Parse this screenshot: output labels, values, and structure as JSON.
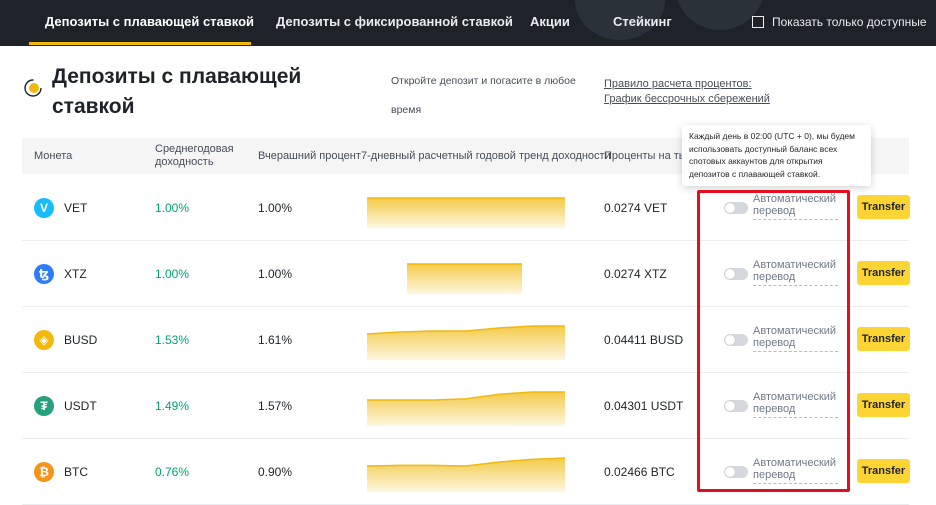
{
  "nav": {
    "tabs": [
      {
        "label": "Депозиты с плавающей ставкой",
        "active": true
      },
      {
        "label": "Депозиты с фиксированной ставкой",
        "active": false
      },
      {
        "label": "Акции",
        "active": false
      },
      {
        "label": "Стейкинг",
        "active": false
      }
    ],
    "show_available_label": "Показать только доступные"
  },
  "header": {
    "title": "Депозиты с плавающей ставкой",
    "description": "Откройте депозит и погасите в любое время",
    "rule_link_1": "Правило расчета процентов:",
    "rule_link_2": "График бессрочных сбережений"
  },
  "table": {
    "columns": {
      "coin": "Монета",
      "apy": "Среднегодовая доходность",
      "yesterday": "Вчерашний процент",
      "trend": "7-дневный расчетный годовой тренд доходности",
      "interest": "Проценты на тыс"
    },
    "tooltip": "Каждый день в 02:00 (UTC + 0), мы будем использовать доступный баланс всех спотовых аккаунтов для открытия депозитов с плавающей ставкой.",
    "auto_transfer_label": "Автоматический перевод",
    "transfer_label": "Transfer",
    "rows": [
      {
        "coin": "VET",
        "apy": "1.00%",
        "yesterday": "1.00%",
        "interest": "0.0274 VET",
        "icon": "vet-icon",
        "color": "#15bdff",
        "glyph": "V",
        "trend": [
          1.0,
          1.0,
          1.0,
          1.0,
          1.0,
          1.0,
          1.0
        ]
      },
      {
        "coin": "XTZ",
        "apy": "1.00%",
        "yesterday": "1.00%",
        "interest": "0.0274 XTZ",
        "icon": "xtz-icon",
        "color": "#2c7df7",
        "glyph": "ꜩ",
        "trend": [
          1.0,
          1.0,
          1.0,
          1.0
        ]
      },
      {
        "coin": "BUSD",
        "apy": "1.53%",
        "yesterday": "1.61%",
        "interest": "0.04411 BUSD",
        "icon": "busd-icon",
        "color": "#f0b90b",
        "glyph": "◈",
        "trend": [
          1.5,
          1.52,
          1.53,
          1.53,
          1.56,
          1.58,
          1.58
        ]
      },
      {
        "coin": "USDT",
        "apy": "1.49%",
        "yesterday": "1.57%",
        "interest": "0.04301 USDT",
        "icon": "usdt-icon",
        "color": "#26a17b",
        "glyph": "₮",
        "trend": [
          1.48,
          1.48,
          1.48,
          1.49,
          1.53,
          1.55,
          1.55
        ]
      },
      {
        "coin": "BTC",
        "apy": "0.76%",
        "yesterday": "0.90%",
        "interest": "0.02466 BTC",
        "icon": "btc-icon",
        "color": "#f7931a",
        "glyph": "₿",
        "trend": [
          0.72,
          0.73,
          0.73,
          0.72,
          0.78,
          0.82,
          0.84
        ]
      }
    ]
  },
  "colors": {
    "accent": "#f0b90b",
    "positive": "#03a66d",
    "highlight": "#e0101f"
  }
}
